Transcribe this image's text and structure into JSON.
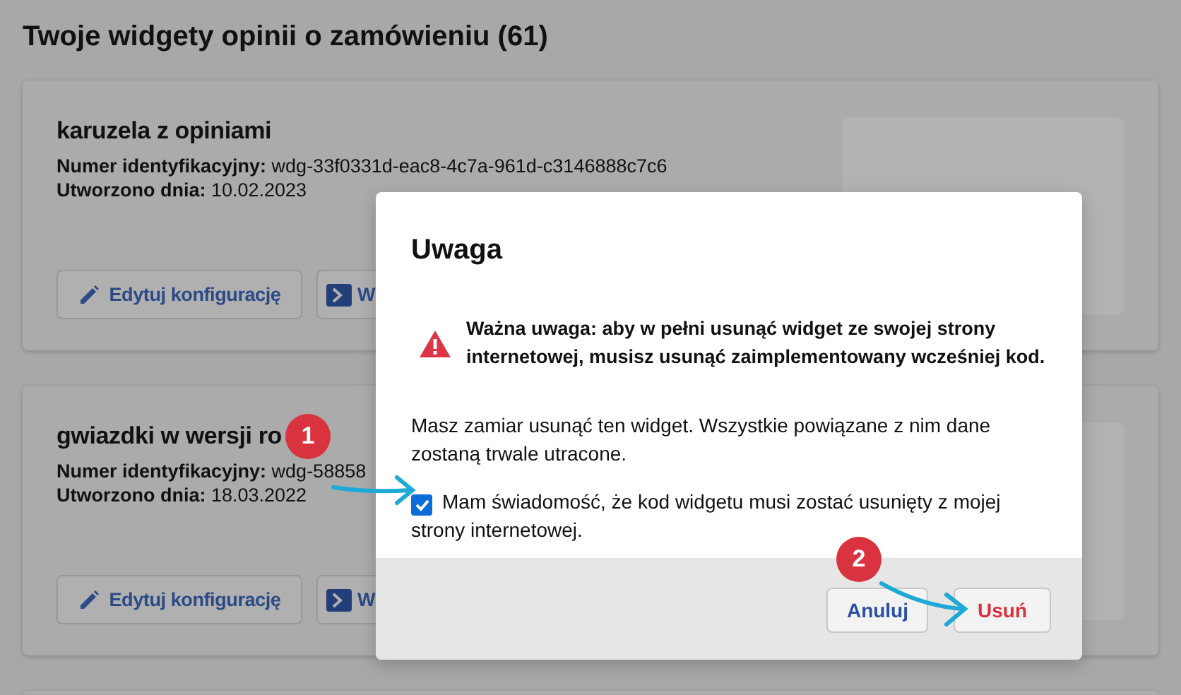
{
  "page_title": "Twoje widgety opinii o zamówieniu (61)",
  "widgets": [
    {
      "name": "karuzela z opiniami",
      "id_label": "Numer identyfikacyjny:",
      "id": "wdg-33f0331d-eac8-4c7a-961d-c3146888c7c6",
      "created_label": "Utworzono dnia:",
      "created": "10.02.2023",
      "buttons": [
        {
          "kind": "edit",
          "label": "Edytuj konfigurację"
        },
        {
          "kind": "code",
          "label": "W"
        }
      ]
    },
    {
      "name": "gwiazdki w wersji ro",
      "id_label": "Numer identyfikacyjny:",
      "id": "wdg-58858",
      "created_label": "Utworzono dnia:",
      "created": "18.03.2022",
      "buttons": [
        {
          "kind": "edit",
          "label": "Edytuj konfigurację"
        },
        {
          "kind": "code",
          "label": "W"
        }
      ]
    }
  ],
  "dialog": {
    "title": "Uwaga",
    "warning": "Ważna uwaga: aby w pełni usunąć widget ze swojej strony internetowej, musisz usunąć zaimplementowany wcześniej kod.",
    "message": "Masz zamiar usunąć ten widget. Wszystkie powiązane z nim dane zostaną trwale utracone.",
    "confirm": {
      "label": "Mam świadomość, że kod widgetu musi zostać usunięty z mojej strony internetowej.",
      "checked": true
    },
    "buttons": [
      {
        "kind": "cancel",
        "label": "Anuluj"
      },
      {
        "kind": "danger",
        "label": "Usuń"
      }
    ]
  },
  "annotations": [
    {
      "number": "1"
    },
    {
      "number": "2"
    }
  ]
}
